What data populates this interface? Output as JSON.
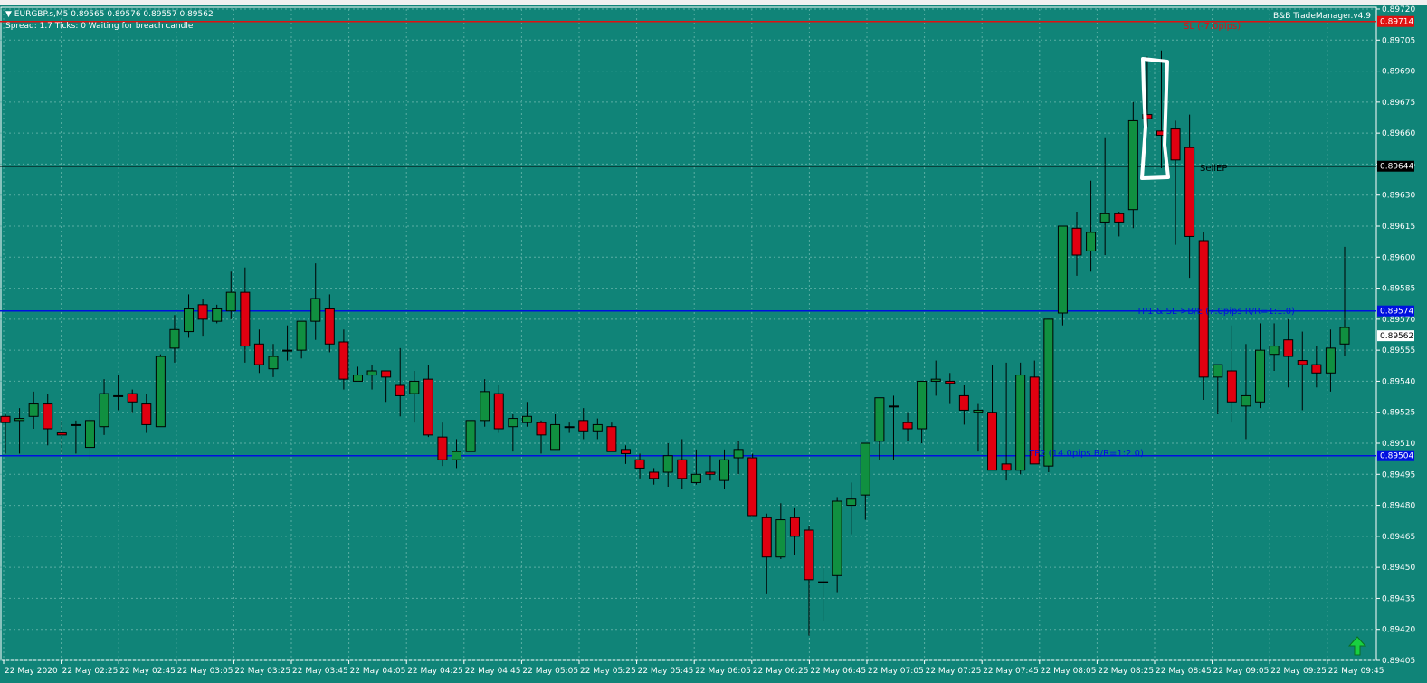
{
  "window": {
    "symbol_info": "EURGBP.s,M5  0.89565 0.89576 0.89557 0.89562",
    "status": "Spread: 1.7   Ticks: 0   Waiting for breach candle",
    "ea_name": "B&B TradeManager.v4.9"
  },
  "colors": {
    "background": "#108478",
    "bull": "#109040",
    "bear": "#e00010",
    "sl_line": "#e01010",
    "entry_line": "#000000",
    "tp_line": "#0010e0",
    "grid": "#5aaea4"
  },
  "icons": {
    "arrow": "green-up-arrow-icon",
    "menu": "dropdown-triangle-icon"
  },
  "levels": {
    "sl": {
      "price": 0.89714,
      "label": "SL (-7.0pips)",
      "tag": "0.89714"
    },
    "entry": {
      "price": 0.89644,
      "label": "SellEP",
      "tag": "0.89644"
    },
    "tp1": {
      "price": 0.89574,
      "label": "TP1 & SL->B/E (7.0pips R/R=1:1.0)",
      "tag": "0.89574"
    },
    "tp2": {
      "price": 0.89504,
      "label": "TP2 (14.0pips R/R=1:2.0)",
      "tag": "0.89504"
    },
    "bid": {
      "price": 0.89562,
      "tag": "0.89562"
    }
  },
  "chart_data": {
    "type": "candlestick",
    "symbol": "EURGBP.s",
    "timeframe": "M5",
    "ylim": [
      0.89405,
      0.8972
    ],
    "y_ticks": [
      "0.89720",
      "0.89705",
      "0.89690",
      "0.89675",
      "0.89660",
      "0.89645",
      "0.89630",
      "0.89615",
      "0.89600",
      "0.89585",
      "0.89570",
      "0.89555",
      "0.89540",
      "0.89525",
      "0.89510",
      "0.89495",
      "0.89480",
      "0.89465",
      "0.89450",
      "0.89435",
      "0.89420",
      "0.89405"
    ],
    "x_ticks": [
      "22 May 2020",
      "22 May 02:25",
      "22 May 02:45",
      "22 May 03:05",
      "22 May 03:25",
      "22 May 03:45",
      "22 May 04:05",
      "22 May 04:25",
      "22 May 04:45",
      "22 May 05:05",
      "22 May 05:25",
      "22 May 05:45",
      "22 May 06:05",
      "22 May 06:25",
      "22 May 06:45",
      "22 May 07:05",
      "22 May 07:25",
      "22 May 07:45",
      "22 May 08:05",
      "22 May 08:25",
      "22 May 08:45",
      "22 May 09:05",
      "22 May 09:25",
      "22 May 09:45"
    ],
    "grid": true,
    "candles": [
      [
        0.89523,
        0.89524,
        0.89505,
        0.8952
      ],
      [
        0.89521,
        0.89527,
        0.89505,
        0.89522
      ],
      [
        0.89523,
        0.89535,
        0.89517,
        0.89529
      ],
      [
        0.89529,
        0.89534,
        0.89509,
        0.89517
      ],
      [
        0.89515,
        0.89521,
        0.89505,
        0.89514
      ],
      [
        0.89519,
        0.89521,
        0.89505,
        0.89519
      ],
      [
        0.89508,
        0.89523,
        0.89502,
        0.89521
      ],
      [
        0.89518,
        0.89541,
        0.89514,
        0.89534
      ],
      [
        0.89533,
        0.89543,
        0.89526,
        0.89533
      ],
      [
        0.89534,
        0.89536,
        0.89525,
        0.8953
      ],
      [
        0.89529,
        0.89534,
        0.89515,
        0.89519
      ],
      [
        0.89518,
        0.89553,
        0.89518,
        0.89552
      ],
      [
        0.89556,
        0.89572,
        0.89549,
        0.89565
      ],
      [
        0.89564,
        0.89582,
        0.89561,
        0.89575
      ],
      [
        0.89577,
        0.8958,
        0.89562,
        0.8957
      ],
      [
        0.89569,
        0.89577,
        0.89568,
        0.89575
      ],
      [
        0.89574,
        0.89593,
        0.8957,
        0.89583
      ],
      [
        0.89583,
        0.89595,
        0.89549,
        0.89557
      ],
      [
        0.89558,
        0.89565,
        0.89544,
        0.89548
      ],
      [
        0.89546,
        0.89558,
        0.89542,
        0.89552
      ],
      [
        0.89555,
        0.89567,
        0.8955,
        0.89555
      ],
      [
        0.89555,
        0.89569,
        0.89551,
        0.89569
      ],
      [
        0.89569,
        0.89597,
        0.8956,
        0.8958
      ],
      [
        0.89575,
        0.89582,
        0.89554,
        0.89558
      ],
      [
        0.89559,
        0.89565,
        0.89536,
        0.89541
      ],
      [
        0.8954,
        0.89547,
        0.8954,
        0.89543
      ],
      [
        0.89543,
        0.89548,
        0.89536,
        0.89545
      ],
      [
        0.89545,
        0.89543,
        0.8953,
        0.89542
      ],
      [
        0.89538,
        0.89556,
        0.89523,
        0.89533
      ],
      [
        0.89534,
        0.89545,
        0.8952,
        0.8954
      ],
      [
        0.89541,
        0.89548,
        0.89513,
        0.89514
      ],
      [
        0.89513,
        0.8952,
        0.89499,
        0.89502
      ],
      [
        0.89502,
        0.89512,
        0.89498,
        0.89506
      ],
      [
        0.89506,
        0.8952,
        0.89506,
        0.89521
      ],
      [
        0.89521,
        0.89541,
        0.89518,
        0.89535
      ],
      [
        0.89534,
        0.89538,
        0.89515,
        0.89517
      ],
      [
        0.89518,
        0.89524,
        0.89506,
        0.89522
      ],
      [
        0.8952,
        0.8953,
        0.89518,
        0.89523
      ],
      [
        0.8952,
        0.89521,
        0.89505,
        0.89514
      ],
      [
        0.89507,
        0.89524,
        0.89507,
        0.89519
      ],
      [
        0.89518,
        0.8952,
        0.89515,
        0.89518
      ],
      [
        0.89521,
        0.89527,
        0.89512,
        0.89516
      ],
      [
        0.89516,
        0.89522,
        0.89512,
        0.89519
      ],
      [
        0.89518,
        0.8952,
        0.89508,
        0.89506
      ],
      [
        0.89507,
        0.89509,
        0.895,
        0.89505
      ],
      [
        0.89502,
        0.89505,
        0.89493,
        0.89498
      ],
      [
        0.89496,
        0.89498,
        0.8949,
        0.89493
      ],
      [
        0.89496,
        0.8951,
        0.89489,
        0.89504
      ],
      [
        0.89502,
        0.89512,
        0.89488,
        0.89493
      ],
      [
        0.89491,
        0.89507,
        0.8949,
        0.89495
      ],
      [
        0.89496,
        0.89504,
        0.89492,
        0.89495
      ],
      [
        0.89492,
        0.89507,
        0.89488,
        0.89502
      ],
      [
        0.89503,
        0.89511,
        0.89495,
        0.89507
      ],
      [
        0.89503,
        0.89505,
        0.89487,
        0.89475
      ],
      [
        0.89474,
        0.89476,
        0.89437,
        0.89455
      ],
      [
        0.89455,
        0.89481,
        0.89454,
        0.89473
      ],
      [
        0.89474,
        0.89479,
        0.89456,
        0.89465
      ],
      [
        0.89468,
        0.8947,
        0.89417,
        0.89444
      ],
      [
        0.89443,
        0.89451,
        0.89424,
        0.89443
      ],
      [
        0.89446,
        0.89484,
        0.89438,
        0.89482
      ],
      [
        0.8948,
        0.89491,
        0.89466,
        0.89483
      ],
      [
        0.89485,
        0.8951,
        0.89473,
        0.8951
      ],
      [
        0.89511,
        0.89528,
        0.89502,
        0.89532
      ],
      [
        0.89528,
        0.89533,
        0.89502,
        0.89528
      ],
      [
        0.8952,
        0.89525,
        0.89511,
        0.89517
      ],
      [
        0.89517,
        0.89538,
        0.8951,
        0.8954
      ],
      [
        0.8954,
        0.8955,
        0.89533,
        0.89541
      ],
      [
        0.8954,
        0.89544,
        0.89529,
        0.89539
      ],
      [
        0.89533,
        0.89538,
        0.89519,
        0.89526
      ],
      [
        0.89525,
        0.89529,
        0.89506,
        0.89526
      ],
      [
        0.89525,
        0.89548,
        0.895,
        0.89497
      ],
      [
        0.895,
        0.89549,
        0.89492,
        0.89497
      ],
      [
        0.89497,
        0.89549,
        0.89495,
        0.89543
      ],
      [
        0.89542,
        0.8955,
        0.895,
        0.895
      ],
      [
        0.89499,
        0.89557,
        0.89496,
        0.8957
      ],
      [
        0.89573,
        0.89588,
        0.89567,
        0.89615
      ],
      [
        0.89614,
        0.89622,
        0.89591,
        0.89601
      ],
      [
        0.89603,
        0.89637,
        0.89593,
        0.89612
      ],
      [
        0.89617,
        0.89658,
        0.89601,
        0.89621
      ],
      [
        0.89621,
        0.89622,
        0.8961,
        0.89617
      ],
      [
        0.89623,
        0.89675,
        0.89614,
        0.89666
      ],
      [
        0.89669,
        0.89697,
        0.89663,
        0.89667
      ],
      [
        0.89661,
        0.897,
        0.89643,
        0.89659
      ],
      [
        0.89662,
        0.89666,
        0.89606,
        0.89647
      ],
      [
        0.89653,
        0.89669,
        0.8959,
        0.8961
      ],
      [
        0.89608,
        0.89612,
        0.89531,
        0.89542
      ],
      [
        0.89542,
        0.89548,
        0.89524,
        0.89548
      ],
      [
        0.89545,
        0.89567,
        0.8952,
        0.8953
      ],
      [
        0.89528,
        0.89558,
        0.89512,
        0.89533
      ],
      [
        0.8953,
        0.89568,
        0.89527,
        0.89555
      ],
      [
        0.89553,
        0.89568,
        0.89545,
        0.89557
      ],
      [
        0.8956,
        0.8957,
        0.89537,
        0.89552
      ],
      [
        0.8955,
        0.89564,
        0.89526,
        0.89548
      ],
      [
        0.89548,
        0.89557,
        0.89537,
        0.89544
      ],
      [
        0.89544,
        0.89565,
        0.89535,
        0.89556
      ],
      [
        0.89558,
        0.89605,
        0.89552,
        0.89566
      ]
    ]
  }
}
